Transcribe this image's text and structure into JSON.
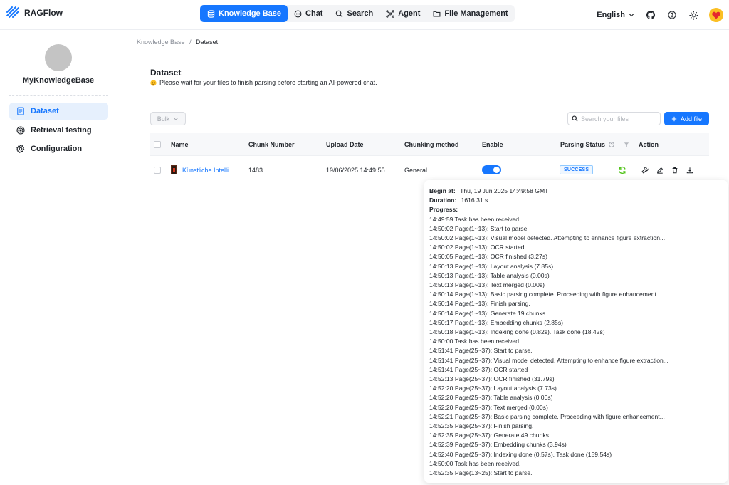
{
  "app": {
    "name": "RAGFlow"
  },
  "nav": {
    "items": [
      {
        "label": "Knowledge Base",
        "icon": "database-icon",
        "active": true
      },
      {
        "label": "Chat",
        "icon": "chat-bubble-icon"
      },
      {
        "label": "Search",
        "icon": "search-icon"
      },
      {
        "label": "Agent",
        "icon": "agent-nodes-icon"
      },
      {
        "label": "File Management",
        "icon": "folder-icon"
      }
    ]
  },
  "header": {
    "language": "English",
    "icons": [
      "github-icon",
      "help-circle-icon",
      "sun-icon",
      "heart-avatar-icon"
    ]
  },
  "sidebar": {
    "kb_name": "MyKnowledgeBase",
    "items": [
      {
        "label": "Dataset",
        "icon": "document-icon",
        "active": true
      },
      {
        "label": "Retrieval testing",
        "icon": "target-icon"
      },
      {
        "label": "Configuration",
        "icon": "gear-icon"
      }
    ]
  },
  "breadcrumb": {
    "parent": "Knowledge Base",
    "separator": "/",
    "current": "Dataset"
  },
  "page": {
    "title": "Dataset",
    "hint": "Please wait for your files to finish parsing before starting an AI-powered chat."
  },
  "toolbar": {
    "bulk_label": "Bulk",
    "search_placeholder": "Search your files",
    "add_file_label": "Add file"
  },
  "table": {
    "columns": {
      "name": "Name",
      "chunk_number": "Chunk Number",
      "upload_date": "Upload Date",
      "chunking_method": "Chunking method",
      "enable": "Enable",
      "parsing_status": "Parsing Status",
      "action": "Action"
    },
    "rows": [
      {
        "name": "Künstliche Intelli...",
        "chunk_number": "1483",
        "upload_date": "19/06/2025 14:49:55",
        "chunking_method": "General",
        "enabled": true,
        "status": "SUCCESS"
      }
    ]
  },
  "progress_popover": {
    "begin_label": "Begin at:",
    "begin_value": "Thu, 19 Jun 2025 14:49:58 GMT",
    "duration_label": "Duration:",
    "duration_value": "1616.31 s",
    "progress_label": "Progress:",
    "lines": [
      "14:49:59 Task has been received.",
      "14:50:02 Page(1~13): Start to parse.",
      "14:50:02 Page(1~13): Visual model detected. Attempting to enhance figure extraction...",
      "14:50:02 Page(1~13): OCR started",
      "14:50:05 Page(1~13): OCR finished (3.27s)",
      "14:50:13 Page(1~13): Layout analysis (7.85s)",
      "14:50:13 Page(1~13): Table analysis (0.00s)",
      "14:50:13 Page(1~13): Text merged (0.00s)",
      "14:50:14 Page(1~13): Basic parsing complete. Proceeding with figure enhancement...",
      "14:50:14 Page(1~13): Finish parsing.",
      "14:50:14 Page(1~13): Generate 19 chunks",
      "14:50:17 Page(1~13): Embedding chunks (2.85s)",
      "14:50:18 Page(1~13): Indexing done (0.82s). Task done (18.42s)",
      "14:50:00 Task has been received.",
      "14:51:41 Page(25~37): Start to parse.",
      "14:51:41 Page(25~37): Visual model detected. Attempting to enhance figure extraction...",
      "14:51:41 Page(25~37): OCR started",
      "14:52:13 Page(25~37): OCR finished (31.79s)",
      "14:52:20 Page(25~37): Layout analysis (7.73s)",
      "14:52:20 Page(25~37): Table analysis (0.00s)",
      "14:52:20 Page(25~37): Text merged (0.00s)",
      "14:52:21 Page(25~37): Basic parsing complete. Proceeding with figure enhancement...",
      "14:52:35 Page(25~37): Finish parsing.",
      "14:52:35 Page(25~37): Generate 49 chunks",
      "14:52:39 Page(25~37): Embedding chunks (3.94s)",
      "14:52:40 Page(25~37): Indexing done (0.57s). Task done (159.54s)",
      "14:50:00 Task has been received.",
      "14:52:35 Page(13~25): Start to parse."
    ]
  },
  "colors": {
    "accent": "#1677ff",
    "success": "#52c41a",
    "muted": "#8a8f98"
  }
}
